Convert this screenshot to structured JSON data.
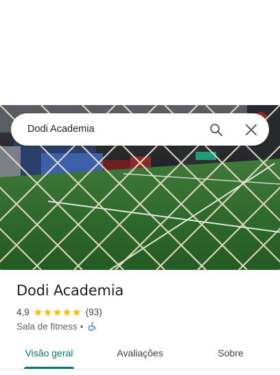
{
  "search": {
    "value": "Dodi Academia",
    "search_icon": "search-icon",
    "close_icon": "close-icon"
  },
  "place": {
    "name": "Dodi Academia",
    "rating": "4,9",
    "stars": 5,
    "review_count": "(93)",
    "category": "Sala de fitness",
    "separator": "•",
    "accessibility_icon": "wheelchair-icon"
  },
  "tabs": [
    {
      "label": "Visão geral",
      "active": true
    },
    {
      "label": "Avaliações",
      "active": false
    },
    {
      "label": "Sobre",
      "active": false
    }
  ],
  "colors": {
    "accent": "#00796b",
    "star": "#fbbc04",
    "accessibility": "#1a73e8"
  }
}
